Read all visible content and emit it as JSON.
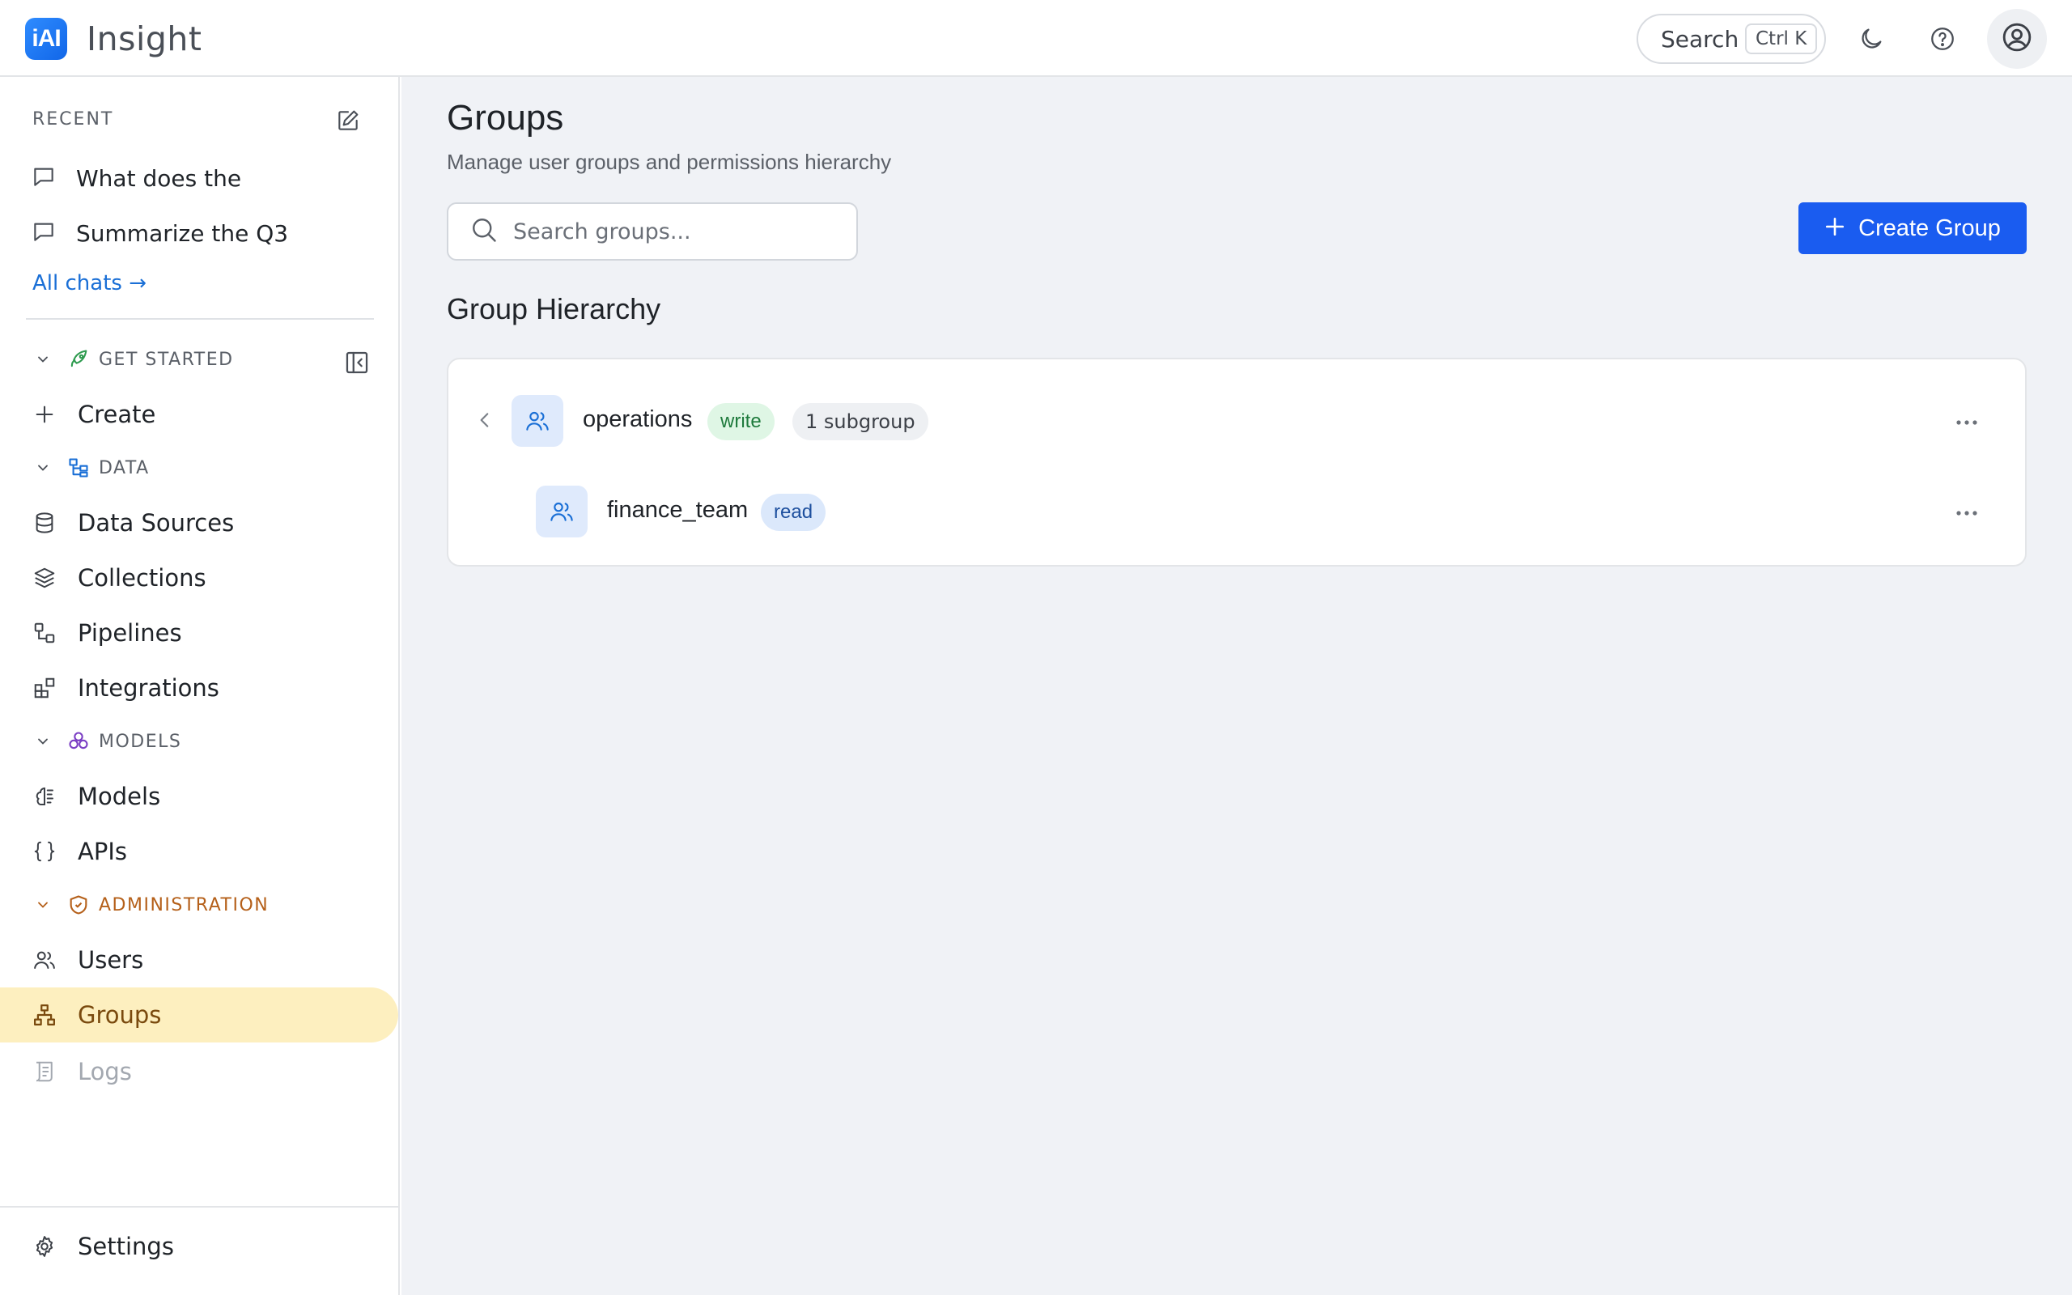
{
  "app": {
    "logo_text": "iAI",
    "title": "Insight"
  },
  "topbar": {
    "search_label": "Search",
    "search_shortcut": "Ctrl K",
    "icons": [
      "moon-icon",
      "help-icon",
      "user-icon"
    ]
  },
  "sidebar": {
    "recent_label": "RECENT",
    "recent_chats": [
      {
        "label": "What does the"
      },
      {
        "label": "Summarize the Q3"
      }
    ],
    "all_chats": "All chats →",
    "sections": {
      "get_started": "GET STARTED",
      "data": "DATA",
      "models": "MODELS",
      "administration": "ADMINISTRATION"
    },
    "items": {
      "create": "Create",
      "data_sources": "Data Sources",
      "collections": "Collections",
      "pipelines": "Pipelines",
      "integrations": "Integrations",
      "models": "Models",
      "apis": "APIs",
      "users": "Users",
      "groups": "Groups",
      "logs": "Logs",
      "settings": "Settings"
    },
    "active_item": "Groups",
    "colors": {
      "active_bg": "#fdefbf",
      "admin_accent": "#b5601a",
      "link": "#1a6fd6"
    }
  },
  "main": {
    "title": "Groups",
    "subtitle": "Manage user groups and permissions hierarchy",
    "search_placeholder": "Search groups...",
    "create_button": "Create Group",
    "hierarchy_title": "Group Hierarchy",
    "groups": [
      {
        "name": "operations",
        "permission": "write",
        "subgroups": "1 subgroup"
      },
      {
        "name": "finance_team",
        "permission": "read"
      }
    ],
    "colors": {
      "primary": "#1a5cf0",
      "write_badge": "#dff6e5",
      "read_badge": "#dbe8fb"
    }
  }
}
